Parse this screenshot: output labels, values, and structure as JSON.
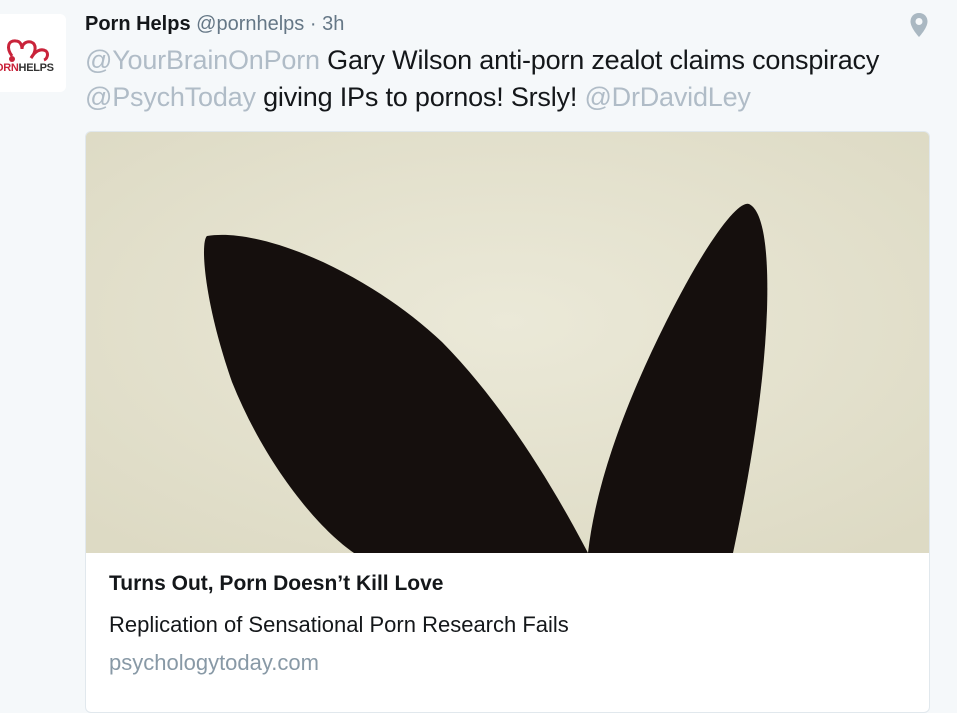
{
  "author": {
    "display_name": "Porn Helps",
    "handle": "@pornhelps",
    "separator": "·",
    "time": "3h",
    "avatar_text_red": "ORN",
    "avatar_text_dark": "HELPS"
  },
  "tweet": {
    "mention_1": "@YourBrainOnPorn",
    "text_1": " Gary Wilson anti-porn zealot claims conspiracy ",
    "mention_2": "@PsychToday",
    "text_2": " giving IPs to pornos! Srsly! ",
    "mention_3": "@DrDavidLey"
  },
  "card": {
    "title": "Turns Out, Porn Doesn’t Kill Love",
    "description": "Replication of Sensational Porn Research Fails",
    "domain": "psychologytoday.com"
  },
  "icons": {
    "location": "location-pin-icon",
    "avatar": "pornhelps-logo",
    "card_image": "bunny-ears-image"
  },
  "colors": {
    "background": "#f5f8fa",
    "name": "#14171a",
    "meta": "#657786",
    "mention": "#b0bcc7",
    "brand_red": "#c9233a"
  }
}
